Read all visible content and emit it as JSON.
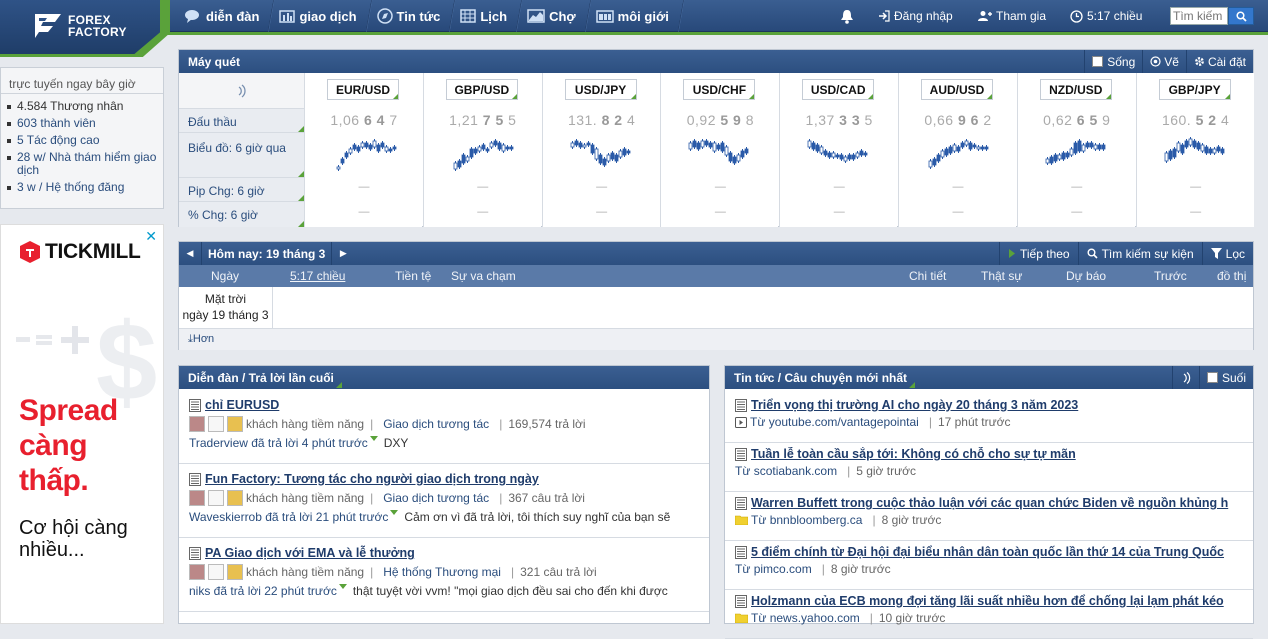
{
  "brand": {
    "line1": "FOREX",
    "line2": "FACTORY"
  },
  "nav": {
    "items": [
      {
        "label": "diễn đàn",
        "icon": "forum-icon"
      },
      {
        "label": "giao dịch",
        "icon": "trades-icon"
      },
      {
        "label": "Tin tức",
        "icon": "news-icon"
      },
      {
        "label": "Lịch",
        "icon": "calendar-icon"
      },
      {
        "label": "Chợ",
        "icon": "market-icon"
      },
      {
        "label": "môi giới",
        "icon": "brokers-icon"
      }
    ],
    "login": "Đăng nhập",
    "join": "Tham gia",
    "time": "5:17 chiều",
    "search_placeholder": "Tìm kiếm"
  },
  "sidebar": {
    "header": "trực tuyến ngay bây giờ",
    "items": [
      {
        "label": "4.584 Thương nhân",
        "link": false
      },
      {
        "label": "603 thành viên",
        "link": true
      },
      {
        "label": "5 Tác động cao",
        "link": true
      },
      {
        "label": "28 w/ Nhà thám hiểm giao dịch",
        "link": true
      },
      {
        "label": "3 w / Hệ thống đăng",
        "link": true
      }
    ]
  },
  "ad": {
    "brand": "TICKMILL",
    "headline_1": "Spread",
    "headline_2": "càng",
    "headline_3": "thấp.",
    "sub_1": "Cơ hội càng",
    "sub_2": "nhiều..."
  },
  "scanner": {
    "title": "Máy quét",
    "live": "Sống",
    "draw": "Vẽ",
    "settings": "Cài đặt",
    "labels": [
      "Đấu thầu",
      "Biểu đồ: 6 giờ qua",
      "Pip Chg: 6 giờ",
      "% Chg: 6 giờ"
    ],
    "pairs": [
      {
        "name": "EUR/USD",
        "price_a": "1,06",
        "price_b": "6 4",
        "price_c": "7",
        "pip": "—",
        "pct": "—"
      },
      {
        "name": "GBP/USD",
        "price_a": "1,21",
        "price_b": "7 5",
        "price_c": "5",
        "pip": "—",
        "pct": "—"
      },
      {
        "name": "USD/JPY",
        "price_a": "131.",
        "price_b": "8 2",
        "price_c": "4",
        "pip": "—",
        "pct": "—"
      },
      {
        "name": "USD/CHF",
        "price_a": "0,92",
        "price_b": "5 9",
        "price_c": "8",
        "pip": "—",
        "pct": "—"
      },
      {
        "name": "USD/CAD",
        "price_a": "1,37",
        "price_b": "3 3",
        "price_c": "5",
        "pip": "—",
        "pct": "—"
      },
      {
        "name": "AUD/USD",
        "price_a": "0,66",
        "price_b": "9 6",
        "price_c": "2",
        "pip": "—",
        "pct": "—"
      },
      {
        "name": "NZD/USD",
        "price_a": "0,62",
        "price_b": "6 5",
        "price_c": "9",
        "pip": "—",
        "pct": "—"
      },
      {
        "name": "GBP/JPY",
        "price_a": "160.",
        "price_b": "5 2",
        "price_c": "4",
        "pip": "—",
        "pct": "—"
      }
    ]
  },
  "calendar": {
    "title": "Hôm nay: 19 tháng 3",
    "next": "Tiếp theo",
    "search": "Tìm kiếm sự kiện",
    "filter": "Lọc",
    "columns": {
      "day": "Ngày",
      "time": "5:17 chiều",
      "currency": "Tiền tệ",
      "impact": "Sự va chạm",
      "detail": "Chi tiết",
      "actual": "Thật sự",
      "forecast": "Dự báo",
      "previous": "Trước",
      "graph": "đồ thị"
    },
    "row_day_1": "Mặt trời",
    "row_day_2": "ngày 19 tháng 3",
    "more": "Hơn"
  },
  "forum": {
    "title": "Diễn đàn / Trả lời lần cuối",
    "threads": [
      {
        "title": "chỉ EURUSD",
        "meta_text": "khách hàng tiềm năng",
        "category": "Giao dịch tương tác",
        "replies": "169,574 trả lời",
        "last_link": "Traderview đã trả lời 4 phút trước",
        "last_text": "DXY"
      },
      {
        "title": "Fun Factory: Tương tác cho người giao dịch trong ngày",
        "meta_text": "khách hàng tiềm năng",
        "category": "Giao dịch tương tác",
        "replies": "367 câu trả lời",
        "last_link": "Waveskierrob đã trả lời 21 phút trước",
        "last_text": "Cảm ơn vì đã trả lời, tôi thích suy nghĩ của bạn sẽ"
      },
      {
        "title": "PA Giao dịch với EMA và lễ thưởng",
        "meta_text": "khách hàng tiềm năng",
        "category": "Hệ thống Thương mại",
        "replies": "321 câu trả lời",
        "last_link": "niks đã trả lời 22 phút trước",
        "last_text": "thật tuyệt vời vvm! \"mọi giao dịch đều sai cho đến khi được"
      }
    ]
  },
  "news": {
    "title": "Tin tức / Câu chuyện mới nhất",
    "sleep": "Suối",
    "items": [
      {
        "title": "Triển vọng thị trường AI cho ngày 20 tháng 3 năm 2023",
        "source": "Từ youtube.com/vantagepointai",
        "age": "17 phút trước",
        "src_icon": "video-icon"
      },
      {
        "title": "Tuần lễ toàn cầu sắp tới: Không có chỗ cho sự tự mãn",
        "source": "Từ scotiabank.com",
        "age": "5 giờ trước",
        "src_icon": ""
      },
      {
        "title": "Warren Buffett trong cuộc thảo luận với các quan chức Biden về nguồn khủng h",
        "source": "Từ bnnbloomberg.ca",
        "age": "8 giờ trước",
        "src_icon": "folder-icon"
      },
      {
        "title": "5 điểm chính từ Đại hội đại biểu nhân dân toàn quốc lần thứ 14 của Trung Quốc",
        "source": "Từ pimco.com",
        "age": "8 giờ trước",
        "src_icon": ""
      },
      {
        "title": "Holzmann của ECB mong đợi tăng lãi suất nhiều hơn để chống lại lạm phát kéo",
        "source": "Từ news.yahoo.com",
        "age": "10 giờ trước",
        "src_icon": "folder-icon"
      }
    ]
  }
}
